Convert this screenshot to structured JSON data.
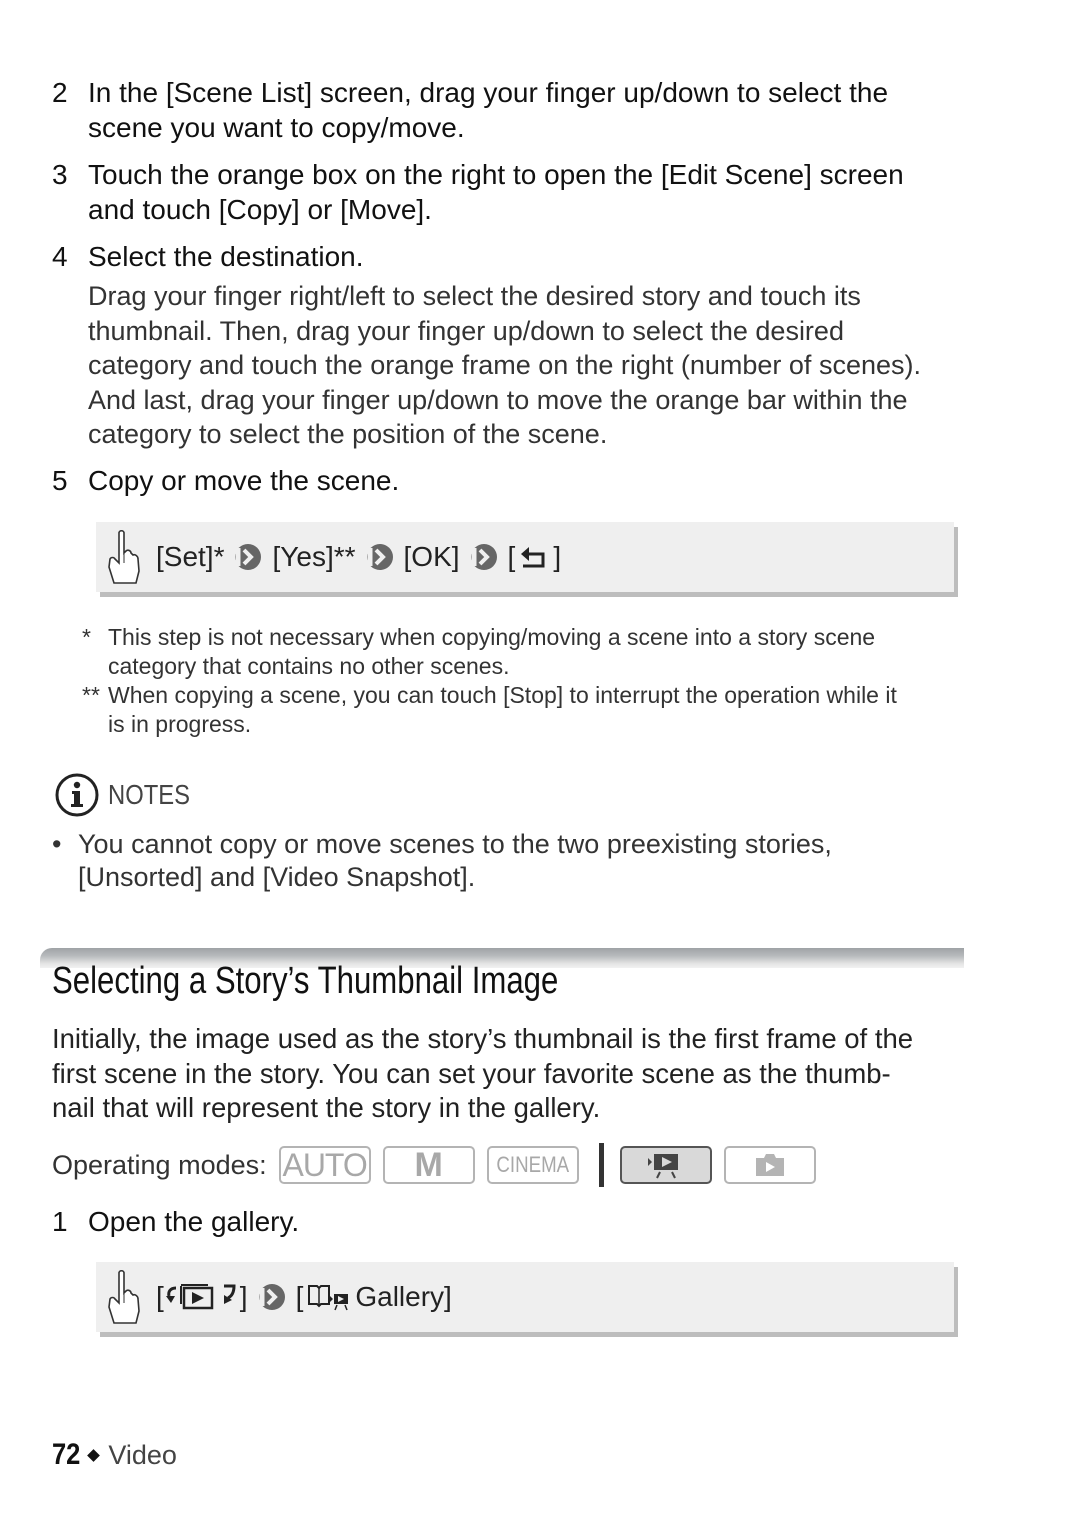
{
  "steps_top": [
    {
      "num": "2",
      "lines": [
        "In the [Scene List] screen, drag your finger up/down to select the",
        "scene you want to copy/move."
      ]
    },
    {
      "num": "3",
      "lines": [
        "Touch the orange box on the right to open the [Edit Scene] screen",
        "and touch [Copy] or [Move]."
      ]
    },
    {
      "num": "4",
      "lines": [
        "Select the destination."
      ]
    }
  ],
  "step4_body": [
    "Drag your finger right/left to select the desired story and touch its",
    "thumbnail. Then, drag your finger up/down to select the desired",
    "category and touch the orange frame on the right (number of scenes).",
    "And last, drag your finger up/down to move the orange bar within the",
    "category to select the position of the scene."
  ],
  "step5": {
    "num": "5",
    "label": "Copy or move the scene."
  },
  "action_box_1": {
    "icon": "touch-hand-icon",
    "items": [
      "[Set]*",
      "[Yes]**",
      "[OK]",
      "["
    ],
    "closing": "]",
    "return_icon": "return-arrow-icon",
    "separator_icon": "next-arrow-icon"
  },
  "footnotes": [
    {
      "mark": "*",
      "lines": [
        "This step is not necessary when copying/moving a scene into a story scene",
        "category that contains no other scenes."
      ]
    },
    {
      "mark": "**",
      "lines": [
        "When copying a scene, you can touch [Stop] to interrupt the operation while it",
        "is in progress."
      ]
    }
  ],
  "notes": {
    "icon": "info-icon",
    "title": "NOTES",
    "bullets": [
      {
        "lines": [
          "You cannot copy or move scenes to the two preexisting stories,",
          "[Unsorted] and [Video Snapshot]."
        ]
      }
    ]
  },
  "section": {
    "title": "Selecting a Story’s Thumbnail Image",
    "intro": [
      "Initially, the image used as the story’s thumbnail is the first frame of the",
      "first scene in the story. You can set your favorite scene as the thumb-",
      "nail that will represent the story in the gallery."
    ],
    "operating_modes_label": "Operating modes:",
    "modes": [
      {
        "label": "AUTO",
        "active": false
      },
      {
        "label": "M",
        "active": false
      },
      {
        "label": "CINEMA",
        "active": false
      },
      {
        "label": "video-playback-icon",
        "active": true
      },
      {
        "label": "photo-playback-icon",
        "active": false
      }
    ],
    "step1": {
      "num": "1",
      "label": "Open the gallery."
    },
    "action_box_2": {
      "open_bracket": "[",
      "close_bracket": "]",
      "second_open": "[",
      "gallery_label": "Gallery]"
    }
  },
  "footer": {
    "page": "72",
    "section": "Video"
  },
  "colors": {
    "box_bg": "#efefef",
    "box_shadow": "#bdbdbd",
    "text": "#222222",
    "mode_inactive": "#a8a8a8"
  }
}
